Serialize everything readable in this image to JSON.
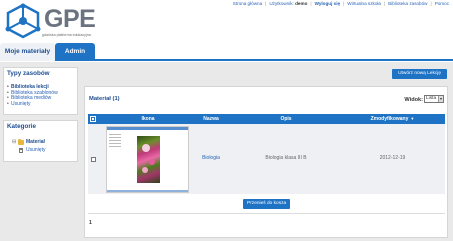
{
  "brand": {
    "name": "GPE",
    "tagline": "gdańska platforma edukacyjna",
    "color": "#6b7280"
  },
  "topnav": {
    "home": "Strona główna",
    "user_label": "Użytkownik:",
    "user_name": "demo",
    "logout": "Wyloguj się",
    "virtual_school": "Wirtualna szkoła",
    "resource_library": "Biblioteka zasobów",
    "help": "Pomoc"
  },
  "tabs": {
    "my_materials": "Moje materiały",
    "admin": "Admin"
  },
  "sidebar": {
    "resource_types": {
      "title": "Typy zasobów",
      "items": [
        {
          "label": "Biblioteka lekcji",
          "active": true
        },
        {
          "label": "Biblioteka szablonów",
          "active": false
        },
        {
          "label": "Biblioteka mediów",
          "active": false
        },
        {
          "label": "Usunięty",
          "active": false
        }
      ]
    },
    "categories": {
      "title": "Kategorie",
      "items": [
        {
          "label": "Materiał",
          "icon": "folder-icon"
        },
        {
          "label": "Usunięty",
          "icon": "trash-icon"
        }
      ]
    }
  },
  "main": {
    "new_lesson_button": "Utwórz nową Lekcję",
    "panel_title": "Materiał (1)",
    "view_label": "Widok:",
    "view_value": "Lista",
    "columns": {
      "icon": "Ikona",
      "name": "Nazwa",
      "description": "Opis",
      "modified": "Zmodyfikowany"
    },
    "rows": [
      {
        "name": "Biologia",
        "description": "Biologia klasa III B",
        "modified": "2012-12-19"
      }
    ],
    "move_to_trash_button": "Przenieś do kosza",
    "page": "1"
  },
  "colors": {
    "accent": "#1f73c5",
    "link": "#2a64b7",
    "title": "#1f4f91"
  }
}
